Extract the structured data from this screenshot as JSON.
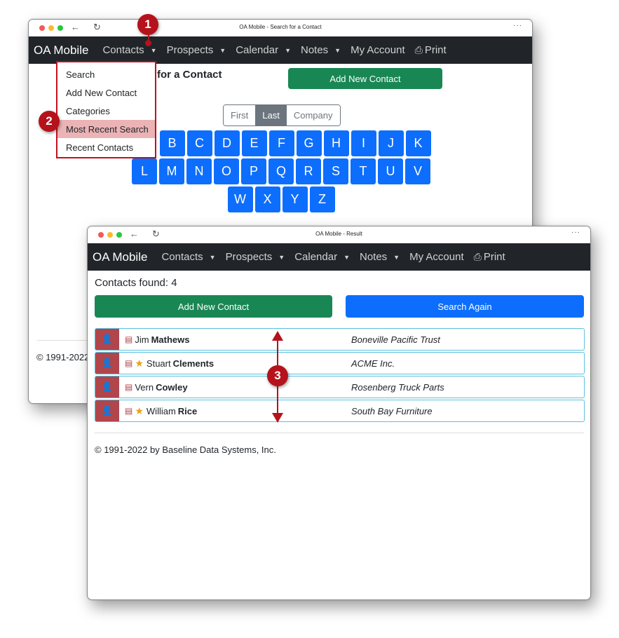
{
  "colors": {
    "navbar": "#212529",
    "success": "#198754",
    "primary": "#0d6efd",
    "secondary": "#6c757d",
    "callout": "#b5121b",
    "highlight": "#ebb3b5",
    "row_icon": "#b0464c",
    "star": "#e5a31c",
    "row_border": "#5bc0de"
  },
  "callouts": [
    "1",
    "2",
    "3"
  ],
  "nav": {
    "brand": "OA Mobile",
    "items": [
      {
        "label": "Contacts",
        "icon": "caret-down-icon"
      },
      {
        "label": "Prospects",
        "icon": "caret-down-icon"
      },
      {
        "label": "Calendar",
        "icon": "caret-down-icon"
      },
      {
        "label": "Notes",
        "icon": "caret-down-icon"
      },
      {
        "label": "My Account"
      },
      {
        "label": "Print",
        "icon": "printer-icon"
      }
    ]
  },
  "back_window": {
    "title": "OA Mobile - Search for a Contact",
    "heading_visible": "for a Contact",
    "add_button": "Add New Contact",
    "search_modes": [
      "First",
      "Last",
      "Company"
    ],
    "active_mode": "Last",
    "letters_row1": [
      "B",
      "C",
      "D",
      "E",
      "F",
      "G",
      "H",
      "I",
      "J",
      "K"
    ],
    "letters_row2": [
      "L",
      "M",
      "N",
      "O",
      "P",
      "Q",
      "R",
      "S",
      "T",
      "U",
      "V"
    ],
    "letters_row3": [
      "W",
      "X",
      "Y",
      "Z"
    ],
    "footer_visible": "© 1991-2022",
    "dropdown": {
      "items": [
        "Search",
        "Add New Contact",
        "Categories",
        "Most Recent Search",
        "Recent Contacts"
      ],
      "highlighted": "Most Recent Search"
    }
  },
  "front_window": {
    "title": "OA Mobile - Result",
    "found_label": "Contacts found: 4",
    "add_button": "Add New Contact",
    "search_again_button": "Search Again",
    "contacts": [
      {
        "first": "Jim",
        "last": "Mathews",
        "company": "Boneville Pacific Trust",
        "starred": false
      },
      {
        "first": "Stuart",
        "last": "Clements",
        "company": "ACME Inc.",
        "starred": true
      },
      {
        "first": "Vern",
        "last": "Cowley",
        "company": "Rosenberg Truck Parts",
        "starred": false
      },
      {
        "first": "William",
        "last": "Rice",
        "company": "South Bay Furniture",
        "starred": true
      }
    ],
    "footer": "© 1991-2022 by Baseline Data Systems, Inc."
  },
  "icons": {
    "back": "←",
    "reload": "↻",
    "more": "···",
    "caret": "▼",
    "printer": "⎙",
    "person": "👤",
    "clipboard": "▤",
    "star": "★"
  }
}
